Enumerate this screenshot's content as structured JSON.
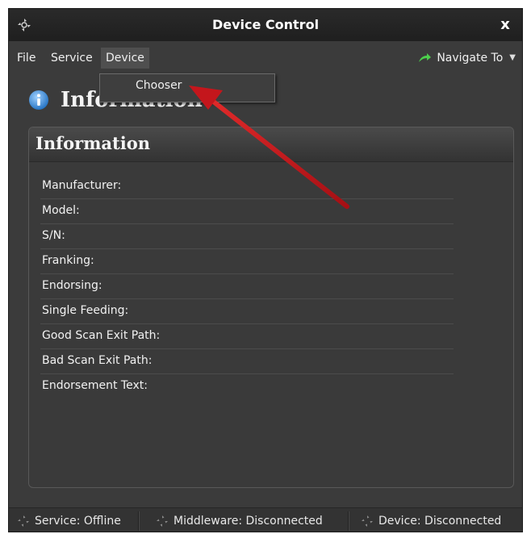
{
  "window": {
    "title": "Device Control",
    "close_label": "x"
  },
  "menubar": {
    "items": [
      {
        "label": "File"
      },
      {
        "label": "Service"
      },
      {
        "label": "Device",
        "active": true
      }
    ],
    "navigate_label": "Navigate To"
  },
  "dropdown": {
    "items": [
      {
        "label": "Chooser"
      }
    ]
  },
  "page_heading": "Information",
  "panel": {
    "title": "Information",
    "fields": [
      "Manufacturer:",
      "Model:",
      "S/N:",
      "Franking:",
      "Endorsing:",
      "Single Feeding:",
      "Good Scan Exit Path:",
      "Bad Scan Exit Path:",
      "Endorsement Text:"
    ]
  },
  "statusbar": {
    "service": "Service: Offline",
    "middleware": "Middleware: Disconnected",
    "device": "Device: Disconnected"
  },
  "colors": {
    "accent_arrow": "#c4161c",
    "nav_arrow": "#3fbf3f",
    "info_icon": "#3b8fd9"
  },
  "icons": [
    "app-logo-icon",
    "close-icon",
    "navigate-arrow-icon",
    "chevron-down-icon",
    "info-icon",
    "status-spinner-icon"
  ]
}
